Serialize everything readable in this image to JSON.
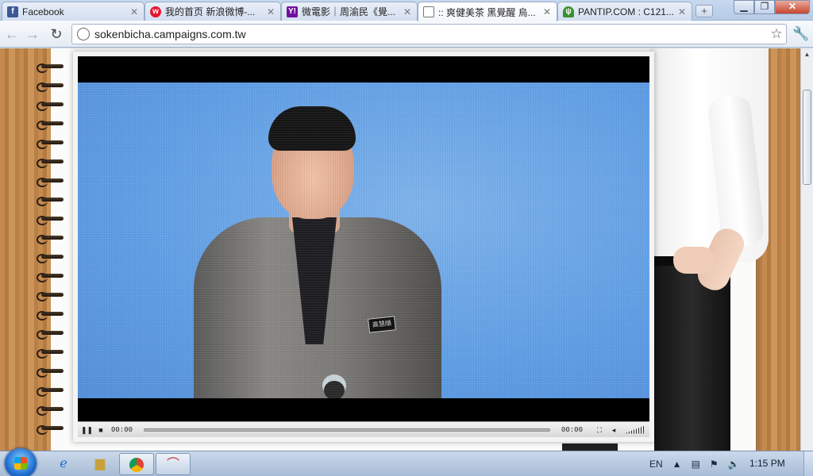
{
  "browser": {
    "tabs": [
      {
        "title": "Facebook",
        "favicon": "facebook-icon",
        "active": false
      },
      {
        "title": "我的首页 新浪微博-...",
        "favicon": "weibo-icon",
        "active": false
      },
      {
        "title": "微電影｜周渝民《覺...",
        "favicon": "yahoo-icon",
        "active": false
      },
      {
        "title": ":: 爽健美茶 黑覺醒 烏...",
        "favicon": "page-icon",
        "active": true
      },
      {
        "title": "PANTIP.COM : C121...",
        "favicon": "cactus-icon",
        "active": false
      }
    ],
    "new_tab_label": "+",
    "url": "sokenbicha.campaigns.com.tw"
  },
  "player": {
    "elapsed": "00:00",
    "duration": "00:00",
    "badge_text": "高慧順"
  },
  "taskbar": {
    "language": "EN",
    "clock": "1:15 PM"
  },
  "colors": {
    "video_bg": "#5f9ee6",
    "wood": "#c48a4e",
    "taskbar": "#b7cbe3"
  }
}
